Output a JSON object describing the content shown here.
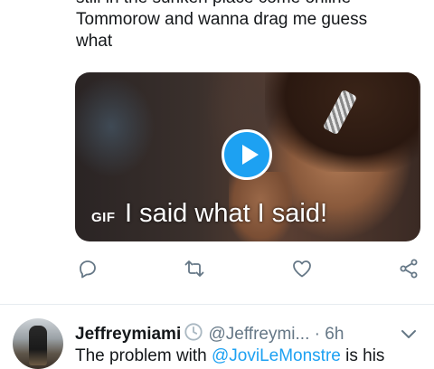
{
  "tweet1": {
    "text_lines": [
      "still in the sunken place come online",
      "Tommorow and wanna drag me guess",
      "what"
    ],
    "media": {
      "type_badge": "GIF",
      "caption": "I said what I said!"
    }
  },
  "actions": {
    "reply_icon": "reply-icon",
    "retweet_icon": "retweet-icon",
    "like_icon": "heart-icon",
    "share_icon": "share-icon"
  },
  "tweet2": {
    "display_name": "Jeffreymiami",
    "badge_icon": "clock-icon",
    "handle": "@Jeffreymi...",
    "separator": "·",
    "time": "6h",
    "text_prefix": "The problem with ",
    "mention": "@JoviLeMonstre",
    "text_suffix": " is his"
  },
  "colors": {
    "accent": "#1da1f2",
    "text": "#14171a",
    "secondary": "#657786",
    "icon": "#657786"
  }
}
